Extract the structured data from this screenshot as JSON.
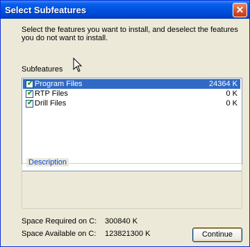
{
  "window": {
    "title": "Select Subfeatures",
    "close_glyph": "✕"
  },
  "intro_text": "Select the features you want to install, and deselect the features you do not want to install.",
  "subfeatures_label": "Subfeatures",
  "features": [
    {
      "name": "Program Files",
      "size": "24364 K",
      "checked": true,
      "selected": true
    },
    {
      "name": "RTP Files",
      "size": "0 K",
      "checked": true,
      "selected": false
    },
    {
      "name": "Drill Files",
      "size": "0 K",
      "checked": true,
      "selected": false
    }
  ],
  "description": {
    "title": "Description",
    "text": ""
  },
  "space": {
    "required_label": "Space Required on C:",
    "required_value": "300840 K",
    "available_label": "Space Available on C:",
    "available_value": "123821300 K"
  },
  "continue_label": "Continue",
  "colors": {
    "selection": "#316AC5",
    "titlebar": "#0053E1",
    "check": "#21A121"
  },
  "icons": {
    "pointer": "arrow-cursor-icon",
    "check": "checkmark-icon",
    "close": "close-icon"
  }
}
